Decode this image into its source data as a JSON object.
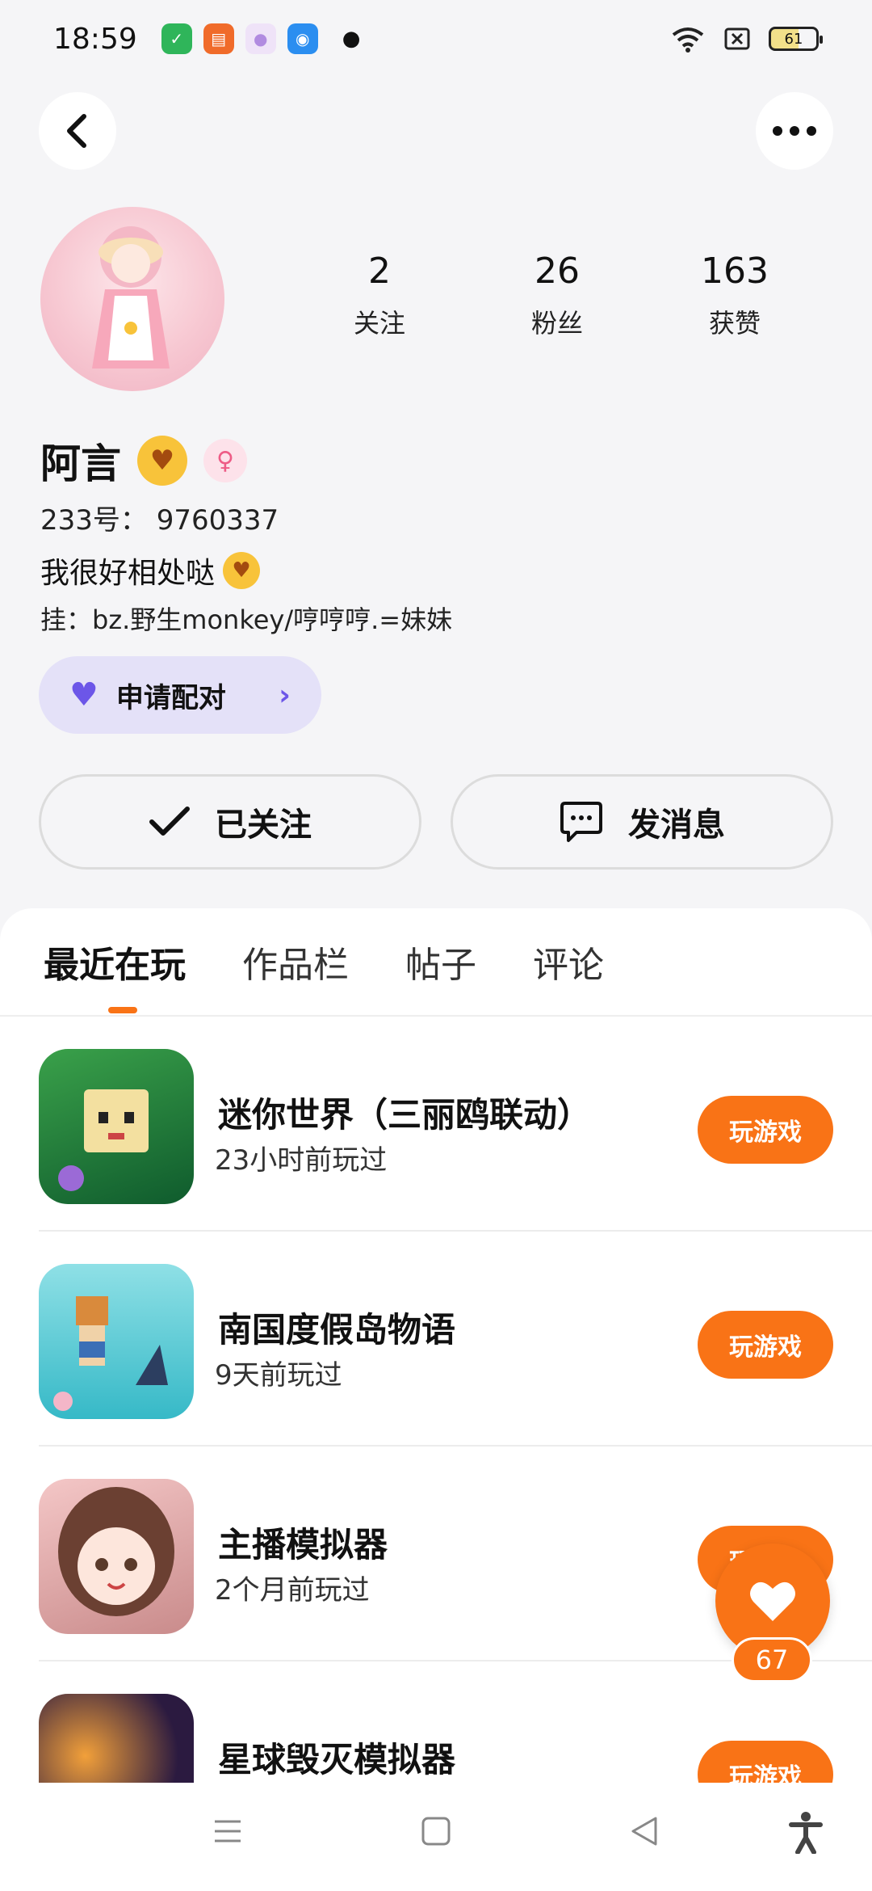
{
  "status_bar": {
    "time": "18:59",
    "battery": "61",
    "app_icons": [
      {
        "name": "wechat-app-icon",
        "color": "#2fb55a"
      },
      {
        "name": "books-app-icon",
        "color": "#f06b2a"
      },
      {
        "name": "flower-app-icon",
        "color": "#e6c8f5"
      },
      {
        "name": "radio-app-icon",
        "color": "#2b8ef0"
      }
    ]
  },
  "profile": {
    "name": "阿言",
    "uid": "233号： 9760337",
    "bio_line1": "我很好相处哒",
    "bio_line2": "挂：bz.野生monkey/哼哼哼.=妹妹",
    "stats": [
      {
        "value": "2",
        "label": "关注"
      },
      {
        "value": "26",
        "label": "粉丝"
      },
      {
        "value": "163",
        "label": "获赞"
      }
    ]
  },
  "actions": {
    "pair_label": "申请配对",
    "follow_label": "已关注",
    "message_label": "发消息"
  },
  "tabs": [
    {
      "label": "最近在玩",
      "active": true
    },
    {
      "label": "作品栏",
      "active": false
    },
    {
      "label": "帖子",
      "active": false
    },
    {
      "label": "评论",
      "active": false
    }
  ],
  "games": [
    {
      "name": "迷你世界（三丽鸥联动）",
      "time": "23小时前玩过",
      "button": "玩游戏"
    },
    {
      "name": "南国度假岛物语",
      "time": "9天前玩过",
      "button": "玩游戏"
    },
    {
      "name": "主播模拟器",
      "time": "2个月前玩过",
      "button": "玩游戏"
    },
    {
      "name": "星球毁灭模拟器",
      "time": "",
      "button": "玩游戏"
    }
  ],
  "like": {
    "count": "67"
  },
  "colors": {
    "accent": "#f97316",
    "pair_bg": "#e4e1f8",
    "pair_icon": "#6c56e8"
  }
}
